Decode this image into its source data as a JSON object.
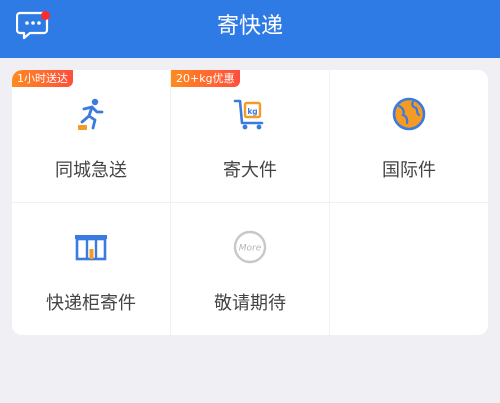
{
  "header": {
    "title": "寄快递"
  },
  "services": [
    {
      "label": "同城急送",
      "badge": "1小时送达",
      "icon": "runner-icon"
    },
    {
      "label": "寄大件",
      "badge": "20+kg优惠",
      "icon": "cart-kg-icon"
    },
    {
      "label": "国际件",
      "badge": "",
      "icon": "globe-icon"
    },
    {
      "label": "快递柜寄件",
      "badge": "",
      "icon": "locker-icon"
    },
    {
      "label": "敬请期待",
      "badge": "",
      "icon": "more-icon"
    }
  ],
  "colors": {
    "header_blue": "#2f7be6",
    "icon_blue": "#3a7be0",
    "icon_orange": "#f59a23",
    "badge_orange": "#ff6a2a",
    "notification_red": "#ff2a2a"
  },
  "icons": {
    "more_text": "More",
    "kg_text": "kg"
  }
}
